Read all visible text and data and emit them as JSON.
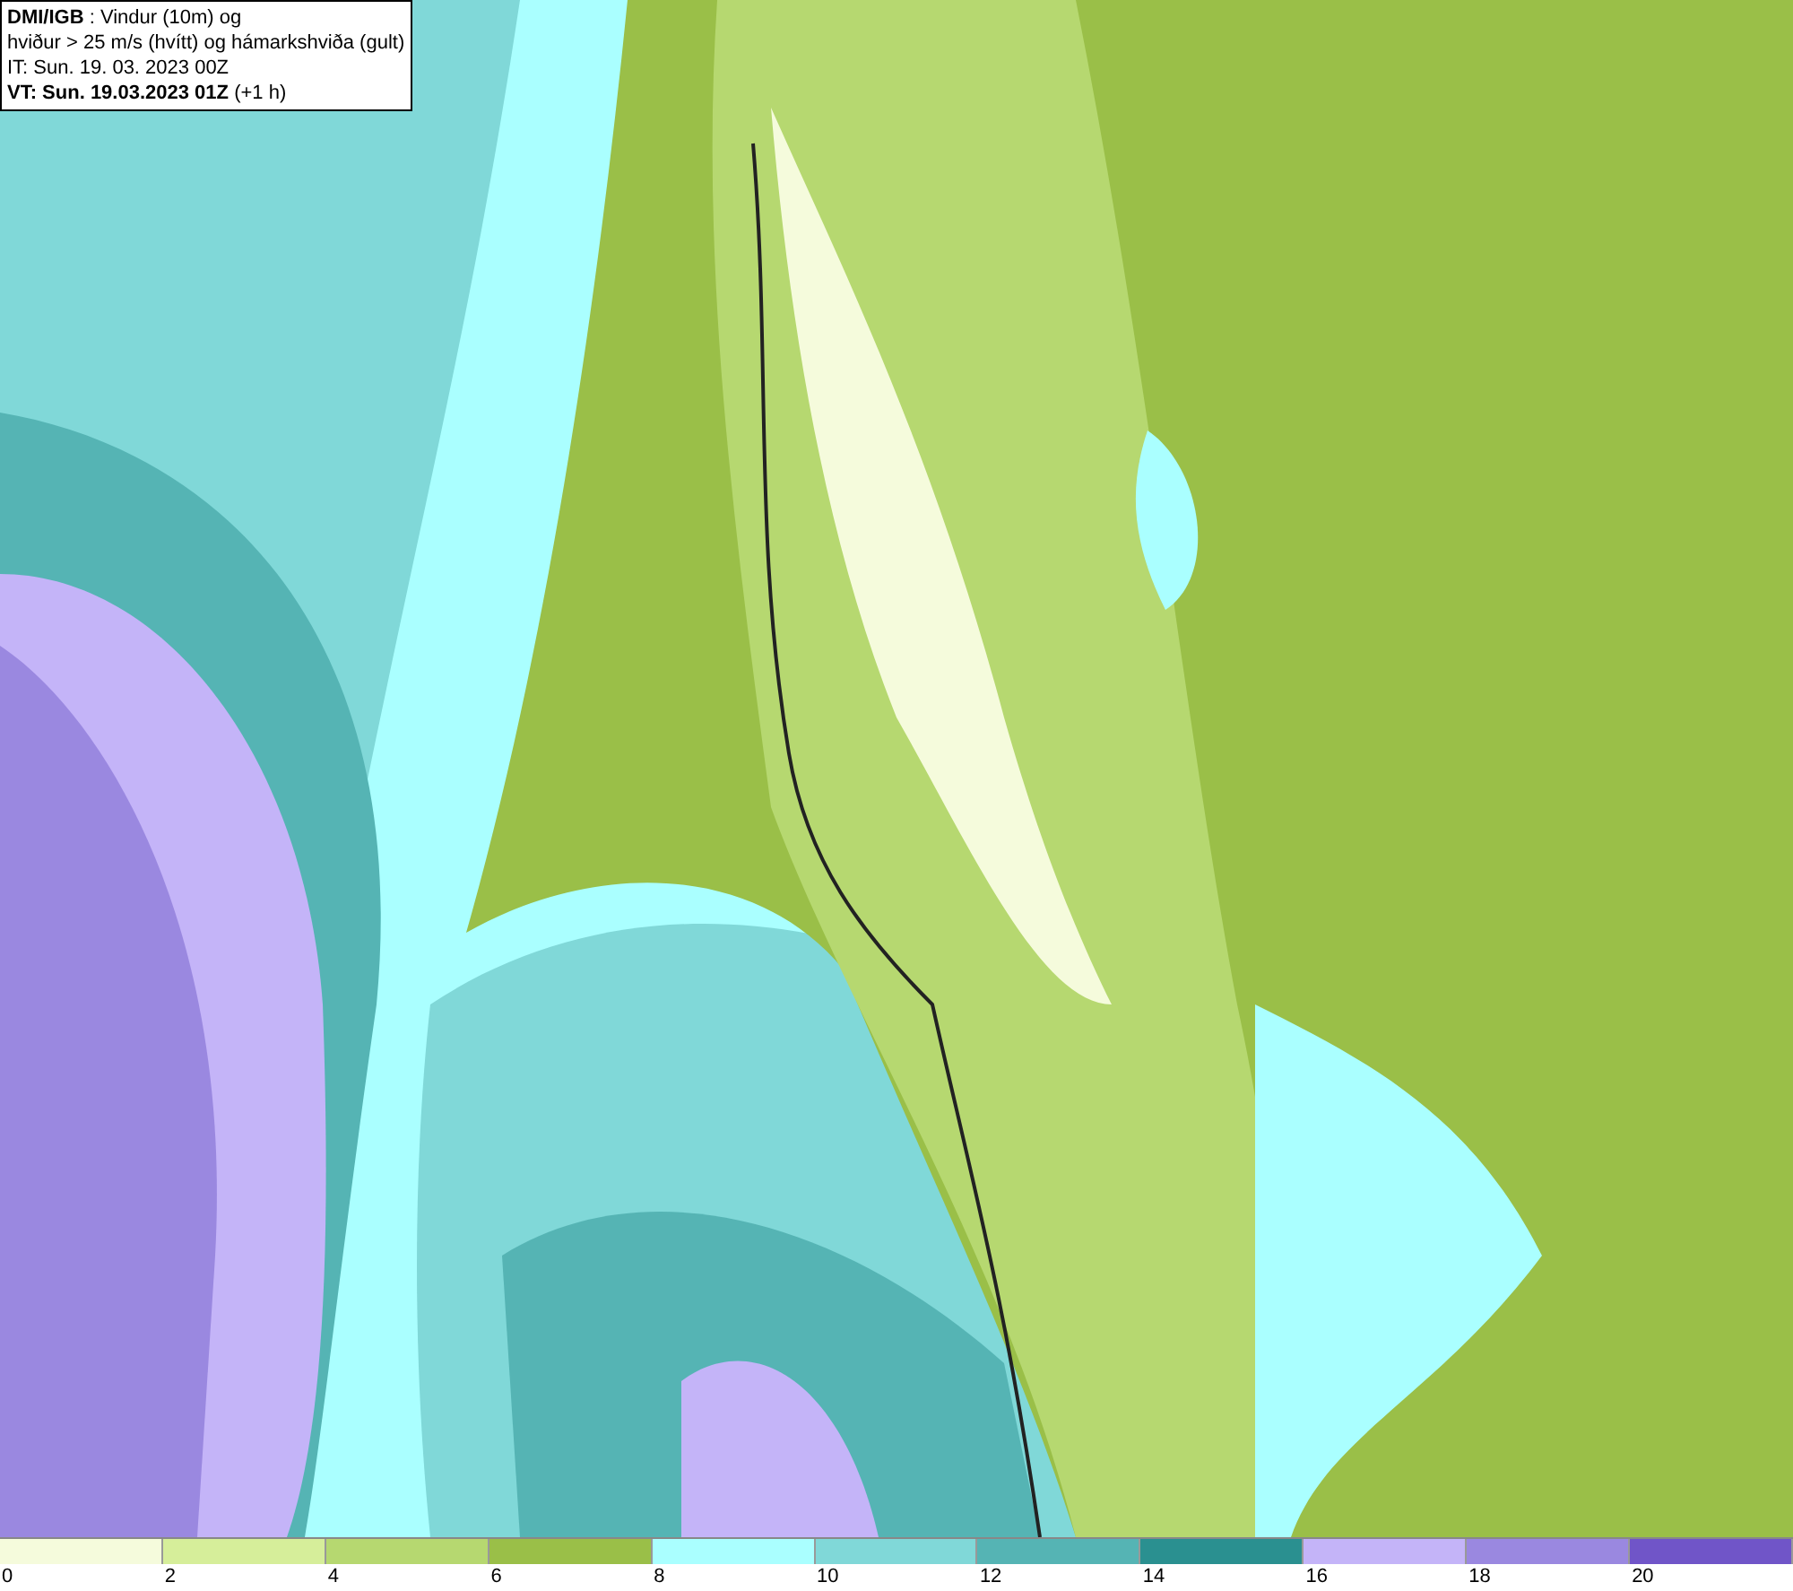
{
  "title_box": {
    "lines": [
      "**DMI/IGB** : Vindur (10m) og",
      "hviður > 25 m/s (hvítt) og hámarkshviða (gult)",
      "IT: Sun. 19. 03. 2023 00Z",
      "**VT: Sun. 19.03.2023 01Z** (+1 h)"
    ]
  },
  "legend": {
    "segments": [
      {
        "color": "#f5fbdc",
        "label": "0"
      },
      {
        "color": "#d6ee9a",
        "label": "2"
      },
      {
        "color": "#b6d870",
        "label": "4"
      },
      {
        "color": "#9abf48",
        "label": "6"
      },
      {
        "color": "#aaffff",
        "label": "8"
      },
      {
        "color": "#80d8d8",
        "label": "10"
      },
      {
        "color": "#55b4b4",
        "label": "12"
      },
      {
        "color": "#2a9090",
        "label": "14"
      },
      {
        "color": "#c4b4f8",
        "label": "16"
      },
      {
        "color": "#9a88e0",
        "label": "18"
      },
      {
        "color": "#7055c8",
        "label": "20"
      }
    ]
  }
}
